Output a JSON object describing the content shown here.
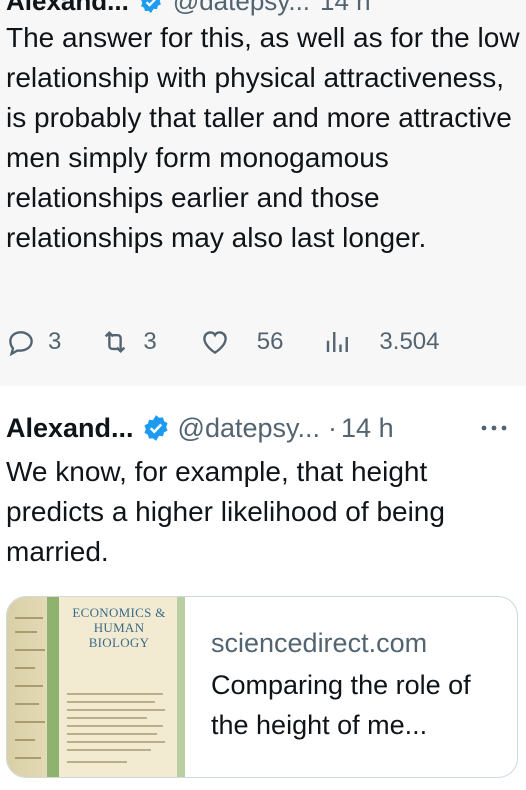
{
  "tweet_top": {
    "author_name": "Alexand...",
    "handle": "@datepsy...",
    "time": "14 h",
    "body": "The answer for this, as well as for the low relationship with physical attractiveness, is probably that taller and more attractive men simply form monogamous relationships earlier and those relationships may also last longer.",
    "replies": "3",
    "reposts": "3",
    "likes": "56",
    "views": "3.504"
  },
  "tweet_bottom": {
    "author_name": "Alexand...",
    "handle": "@datepsy...",
    "separator": "·",
    "time": "14 h",
    "body": "We know, for example, that height predicts a higher likelihood of being married.",
    "card": {
      "thumbnail_title": "ECONOMICS & HUMAN BIOLOGY",
      "domain": "sciencedirect.com",
      "title": "Comparing the role of the height of me..."
    }
  },
  "colors": {
    "verified": "#1d9bf0",
    "secondary_text": "#536471",
    "top_background": "#f7f7f7"
  },
  "icons": [
    "reply-icon",
    "repost-icon",
    "like-icon",
    "views-icon",
    "verified-badge-icon",
    "more-icon"
  ]
}
